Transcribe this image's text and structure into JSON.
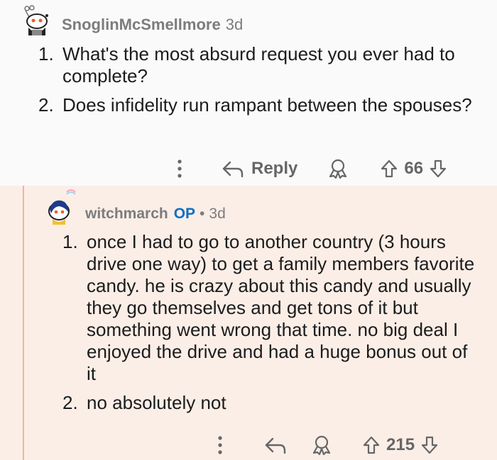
{
  "comment1": {
    "author": "SnoglinMcSmellmore",
    "age": "3d",
    "items": [
      {
        "num": "1.",
        "text": "What's the most absurd request you ever had to complete?"
      },
      {
        "num": "2.",
        "text": "Does infidelity run rampant between the spouses?"
      }
    ],
    "actions": {
      "reply_label": "Reply",
      "score": "66"
    }
  },
  "comment2": {
    "author": "witchmarch",
    "op_badge": "OP",
    "separator": "•",
    "age": "3d",
    "items": [
      {
        "num": "1.",
        "text": "once I had to go to another country (3 hours drive one way) to get a family members favorite candy. he is crazy about this candy and usually they go themselves and get tons of it but something went wrong that time. no big deal I enjoyed the drive and had a huge bonus out of it"
      },
      {
        "num": "2.",
        "text": "no absolutely not"
      }
    ],
    "actions": {
      "score": "215"
    }
  },
  "icons": {
    "more": "more-vertical-icon",
    "reply": "reply-arrow-icon",
    "award": "award-icon",
    "upvote": "upvote-arrow-icon",
    "downvote": "downvote-arrow-icon"
  },
  "colors": {
    "reply_background": "#fbeee7",
    "thread_line": "#f2b39c",
    "op_badge": "#0d6ec1",
    "meta_text": "#7c7c7c"
  }
}
